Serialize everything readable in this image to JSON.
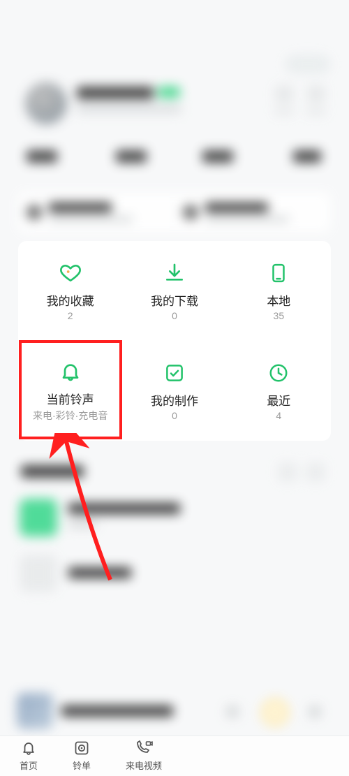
{
  "grid": {
    "favorites": {
      "label": "我的收藏",
      "value": "2"
    },
    "downloads": {
      "label": "我的下载",
      "value": "0"
    },
    "local": {
      "label": "本地",
      "value": "35"
    },
    "current": {
      "label": "当前铃声",
      "sub": "来电·彩铃·充电音"
    },
    "creations": {
      "label": "我的制作",
      "value": "0"
    },
    "recent": {
      "label": "最近",
      "value": "4"
    }
  },
  "nav": {
    "home": "首页",
    "list": "铃单",
    "video": "来电视频"
  },
  "colors": {
    "accent": "#22c26a",
    "highlight": "#ff1f1f"
  }
}
